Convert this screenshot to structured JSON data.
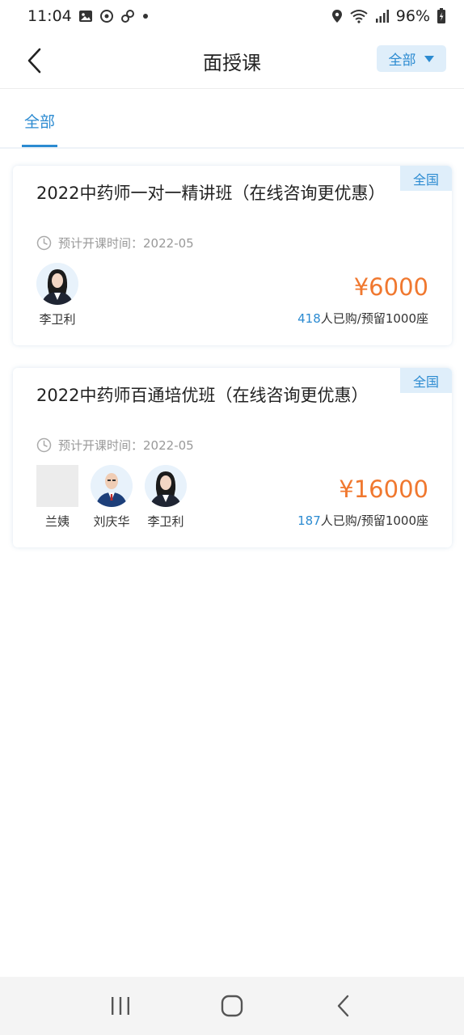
{
  "status_bar": {
    "time": "11:04",
    "battery": "96%",
    "icons": [
      "image-icon",
      "sync-icon",
      "link-icon",
      "dot-icon",
      "location-icon",
      "wifi-icon",
      "signal-icon",
      "battery-icon"
    ]
  },
  "nav": {
    "title": "面授课",
    "filter_label": "全部"
  },
  "tabs": [
    {
      "label": "全部",
      "active": true
    }
  ],
  "courses": [
    {
      "title": "2022中药师一对一精讲班（在线咨询更优惠）",
      "region": "全国",
      "schedule_label": "预计开课时间：",
      "schedule_value": "2022-05",
      "teachers": [
        {
          "name": "李卫利"
        }
      ],
      "price": "¥6000",
      "sold": "418",
      "sold_suffix": "人已购/预留1000座"
    },
    {
      "title": "2022中药师百通培优班（在线咨询更优惠）",
      "region": "全国",
      "schedule_label": "预计开课时间：",
      "schedule_value": "2022-05",
      "teachers": [
        {
          "name": "兰姨"
        },
        {
          "name": "刘庆华"
        },
        {
          "name": "李卫利"
        }
      ],
      "price": "¥16000",
      "sold": "187",
      "sold_suffix": "人已购/预留1000座"
    }
  ],
  "colors": {
    "accent": "#2c8bd1",
    "badge_bg": "#dfeefa",
    "price": "#f0782f"
  }
}
